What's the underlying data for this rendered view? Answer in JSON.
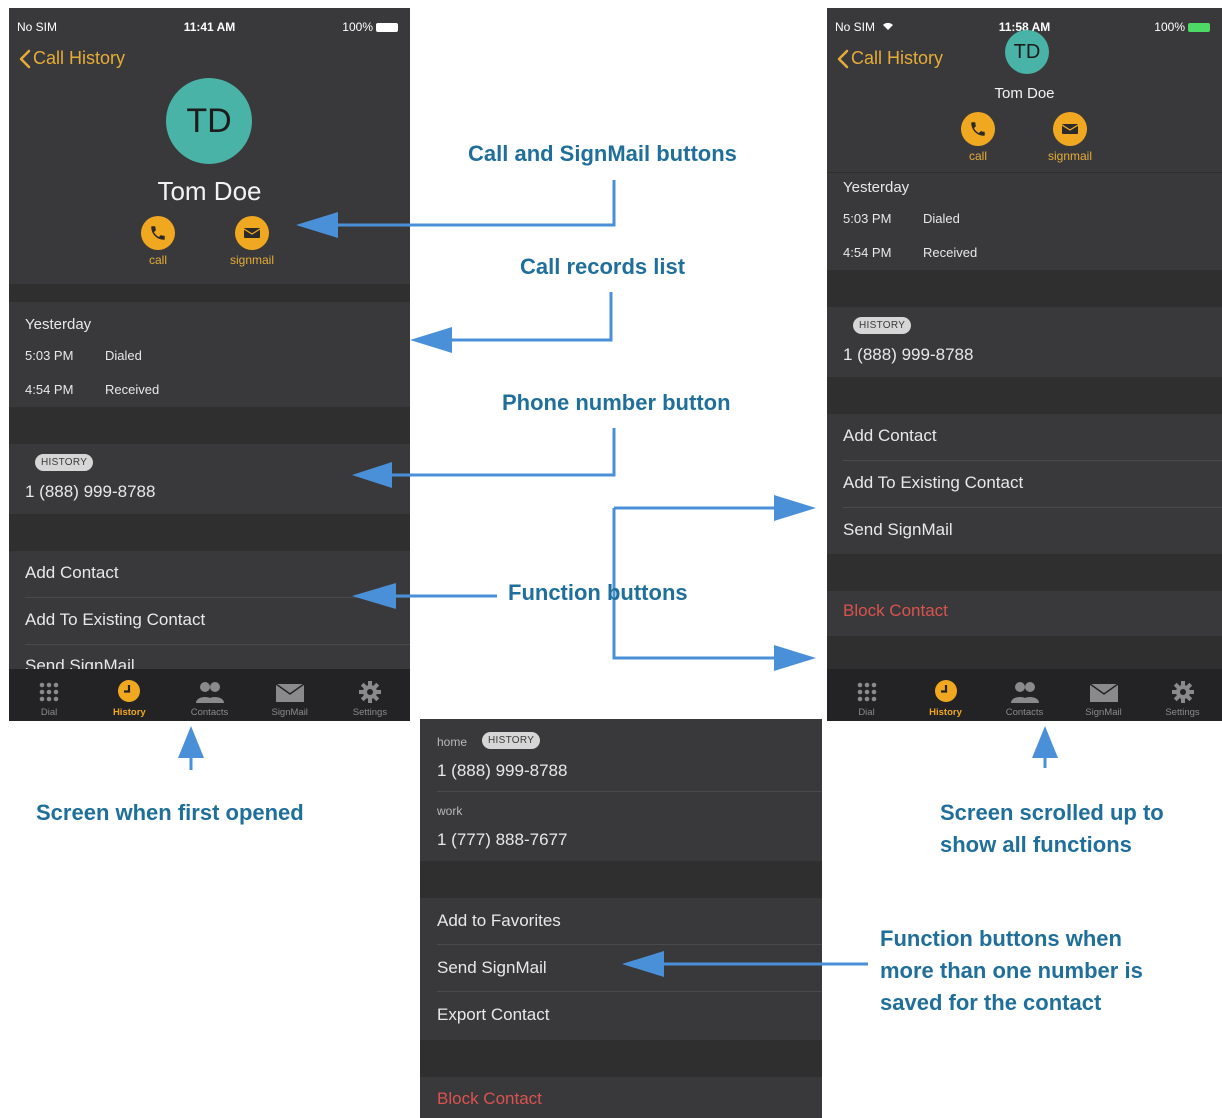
{
  "colors": {
    "accent": "#f0a820",
    "annotation": "#1f6f9a",
    "arrow": "#4a90d9",
    "danger": "#d9534f",
    "avatar": "#4ab3a7"
  },
  "screen1": {
    "status": {
      "carrier": "No SIM",
      "time": "11:41 AM",
      "battery": "100%"
    },
    "back_label": "Call History",
    "avatar_initials": "TD",
    "contact_name": "Tom Doe",
    "call_label": "call",
    "signmail_label": "signmail",
    "records": {
      "day": "Yesterday",
      "items": [
        {
          "time": "5:03 PM",
          "type": "Dialed"
        },
        {
          "time": "4:54 PM",
          "type": "Received"
        }
      ]
    },
    "history_badge": "HISTORY",
    "phone_number": "1 (888) 999-8788",
    "functions": [
      "Add Contact",
      "Add To Existing Contact",
      "Send SignMail"
    ]
  },
  "screen2": {
    "status": {
      "carrier": "No SIM",
      "time": "11:58 AM",
      "battery": "100%"
    },
    "back_label": "Call History",
    "avatar_initials": "TD",
    "contact_name": "Tom Doe",
    "call_label": "call",
    "signmail_label": "signmail",
    "records": {
      "day": "Yesterday",
      "items": [
        {
          "time": "5:03 PM",
          "type": "Dialed"
        },
        {
          "time": "4:54 PM",
          "type": "Received"
        }
      ]
    },
    "history_badge": "HISTORY",
    "phone_number": "1 (888) 999-8788",
    "functions": [
      "Add Contact",
      "Add To Existing Contact",
      "Send SignMail"
    ],
    "block_label": "Block Contact"
  },
  "screen3": {
    "home_label": "home",
    "history_badge": "HISTORY",
    "home_number": "1 (888) 999-8788",
    "work_label": "work",
    "work_number": "1 (777) 888-7677",
    "functions": [
      "Add to Favorites",
      "Send SignMail",
      "Export Contact"
    ],
    "block_label": "Block Contact"
  },
  "tabbar": {
    "items": [
      {
        "label": "Dial",
        "icon": "dial-keypad-icon"
      },
      {
        "label": "History",
        "icon": "clock-icon"
      },
      {
        "label": "Contacts",
        "icon": "contacts-icon"
      },
      {
        "label": "SignMail",
        "icon": "envelope-icon"
      },
      {
        "label": "Settings",
        "icon": "gear-icon"
      }
    ],
    "active": "History"
  },
  "annotations": {
    "call_signmail": "Call and SignMail buttons",
    "call_records": "Call records list",
    "phone_number": "Phone number button",
    "function_buttons": "Function buttons",
    "first_opened": "Screen when first opened",
    "scrolled_line1": "Screen scrolled up to",
    "scrolled_line2": "show all functions",
    "multi_line1": "Function buttons when",
    "multi_line2": "more than one number is",
    "multi_line3": "saved for the contact"
  }
}
